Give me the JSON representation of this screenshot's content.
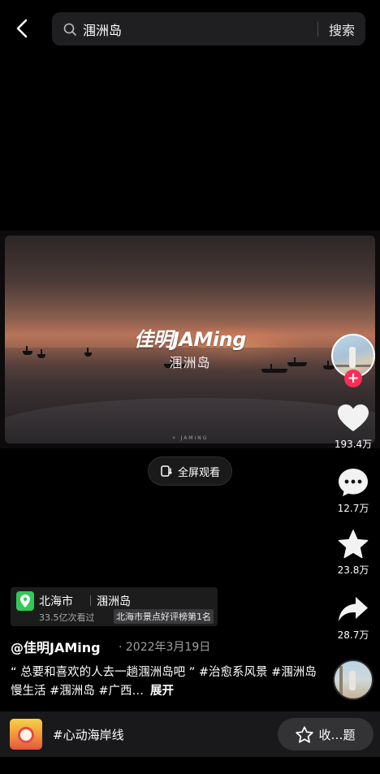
{
  "search": {
    "query": "涠洲岛",
    "button_label": "搜索"
  },
  "video": {
    "title": "佳明JAMing",
    "subtitle": "涠洲岛",
    "watermark": "✧ JAMING",
    "fullscreen_label": "全屏观看"
  },
  "actions": {
    "likes": "193.4万",
    "comments": "12.7万",
    "favorites": "23.8万",
    "shares": "28.7万"
  },
  "location": {
    "city": "北海市",
    "place": "涠洲岛",
    "views": "33.5亿次看过",
    "rank": "北海市景点好评榜第1名"
  },
  "post": {
    "author": "@佳明JAMing",
    "date": "· 2022年3月19日",
    "description": "“ 总要和喜欢的人去一趟涠洲岛吧 ” #治愈系风景 #涠洲岛慢生活 #涠洲岛 #广西…",
    "expand_label": "展开"
  },
  "bottom_bar": {
    "topic": "#心动海岸线",
    "collect_label": "收…题"
  },
  "colors": {
    "accent": "#fe2c55",
    "location_pin": "#34c759"
  },
  "icons": [
    "back-arrow-icon",
    "search-icon",
    "fullscreen-icon",
    "heart-icon",
    "comment-icon",
    "star-icon",
    "share-icon",
    "location-pin-icon"
  ]
}
